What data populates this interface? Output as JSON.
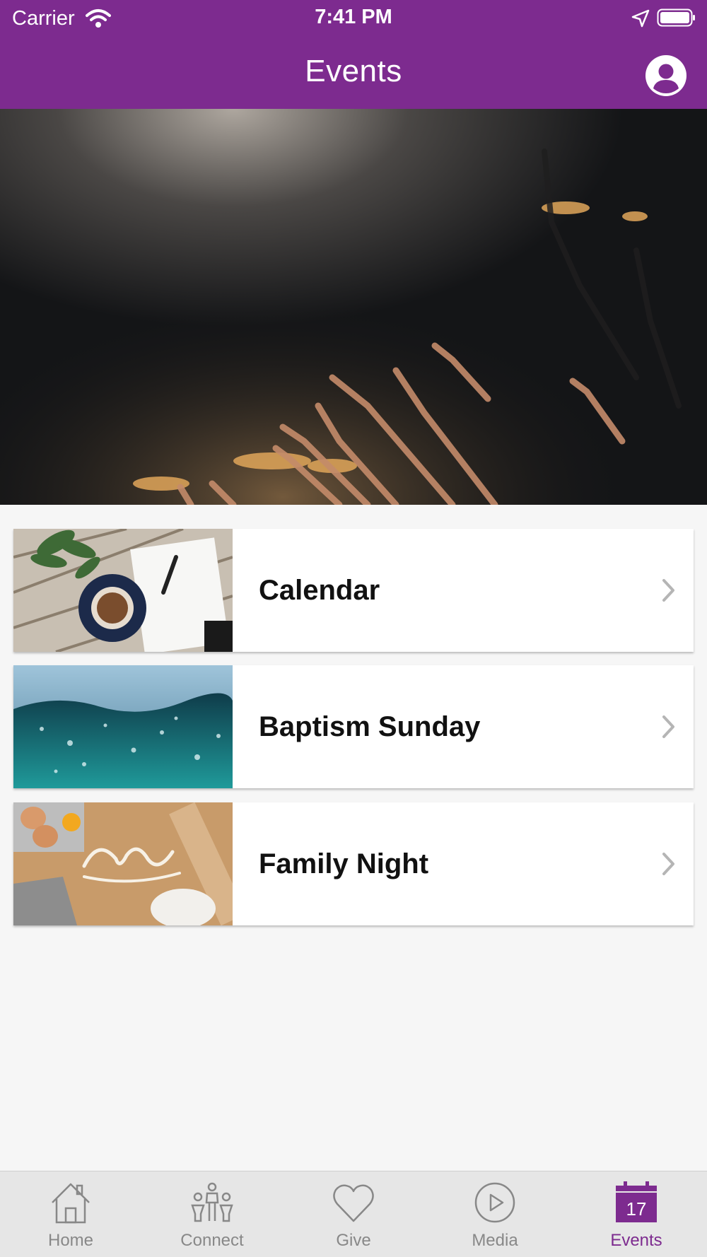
{
  "status_bar": {
    "carrier": "Carrier",
    "time": "7:41 PM"
  },
  "header": {
    "title": "Events"
  },
  "events": [
    {
      "label": "Calendar"
    },
    {
      "label": "Baptism Sunday"
    },
    {
      "label": "Family Night"
    }
  ],
  "tabs": [
    {
      "label": "Home",
      "icon": "house-icon"
    },
    {
      "label": "Connect",
      "icon": "people-icon"
    },
    {
      "label": "Give",
      "icon": "heart-icon"
    },
    {
      "label": "Media",
      "icon": "play-icon"
    },
    {
      "label": "Events",
      "icon": "calendar-icon",
      "badge": "17",
      "active": true
    }
  ],
  "colors": {
    "accent": "#7d2b8f",
    "tab_inactive": "#888888",
    "background": "#f6f6f6"
  }
}
